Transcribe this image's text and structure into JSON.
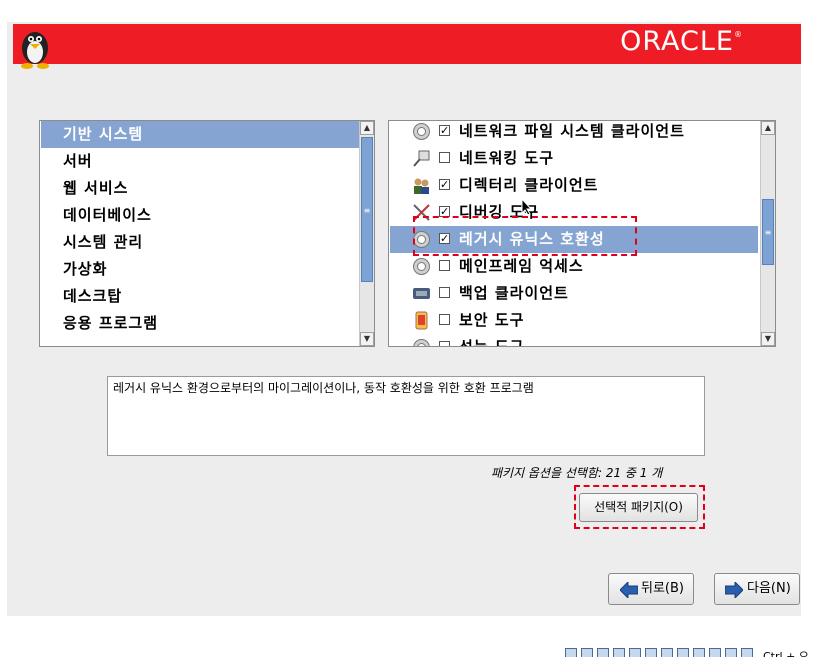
{
  "brand": {
    "logo_text": "ORACLE",
    "reg_mark": "®",
    "banner_color": "#ee1c25"
  },
  "categories": [
    {
      "label": "기반 시스템",
      "selected": true
    },
    {
      "label": "서버",
      "selected": false
    },
    {
      "label": "웹 서비스",
      "selected": false
    },
    {
      "label": "데이터베이스",
      "selected": false
    },
    {
      "label": "시스템 관리",
      "selected": false
    },
    {
      "label": "가상화",
      "selected": false
    },
    {
      "label": "데스크탑",
      "selected": false
    },
    {
      "label": "응용 프로그램",
      "selected": false
    }
  ],
  "packages": [
    {
      "label": "네트워크 파일 시스템 클라이언트",
      "checked": "✓",
      "icon": "gear-icon",
      "selected": false
    },
    {
      "label": "네트워킹 도구",
      "checked": "",
      "icon": "network-tool-icon",
      "selected": false
    },
    {
      "label": "디렉터리 클라이언트",
      "checked": "✓",
      "icon": "users-icon",
      "selected": false
    },
    {
      "label": "디버깅 도구",
      "checked": "✓",
      "icon": "tools-icon",
      "selected": false
    },
    {
      "label": "레거시 유닉스 호환성",
      "checked": "✓",
      "icon": "gear-icon",
      "selected": true
    },
    {
      "label": "메인프레임 억세스",
      "checked": "",
      "icon": "gear-icon",
      "selected": false
    },
    {
      "label": "백업 클라이언트",
      "checked": "",
      "icon": "tape-icon",
      "selected": false
    },
    {
      "label": "보안 도구",
      "checked": "",
      "icon": "security-icon",
      "selected": false
    },
    {
      "label": "성능 도구",
      "checked": "",
      "icon": "gear-icon",
      "selected": false
    }
  ],
  "description": "레거시 유닉스 환경으로부터의 마이그레이션이나, 동작 호환성을 위한 호환 프로그램",
  "package_count": "패키지 옵션을 선택함: 21 중 1 개",
  "optional_packages_button": "선택적 패키지(O)",
  "back_button": "뒤로(B)",
  "next_button": "다음(N)",
  "tray": {
    "ctrl_text": "Ctrl + 오"
  }
}
